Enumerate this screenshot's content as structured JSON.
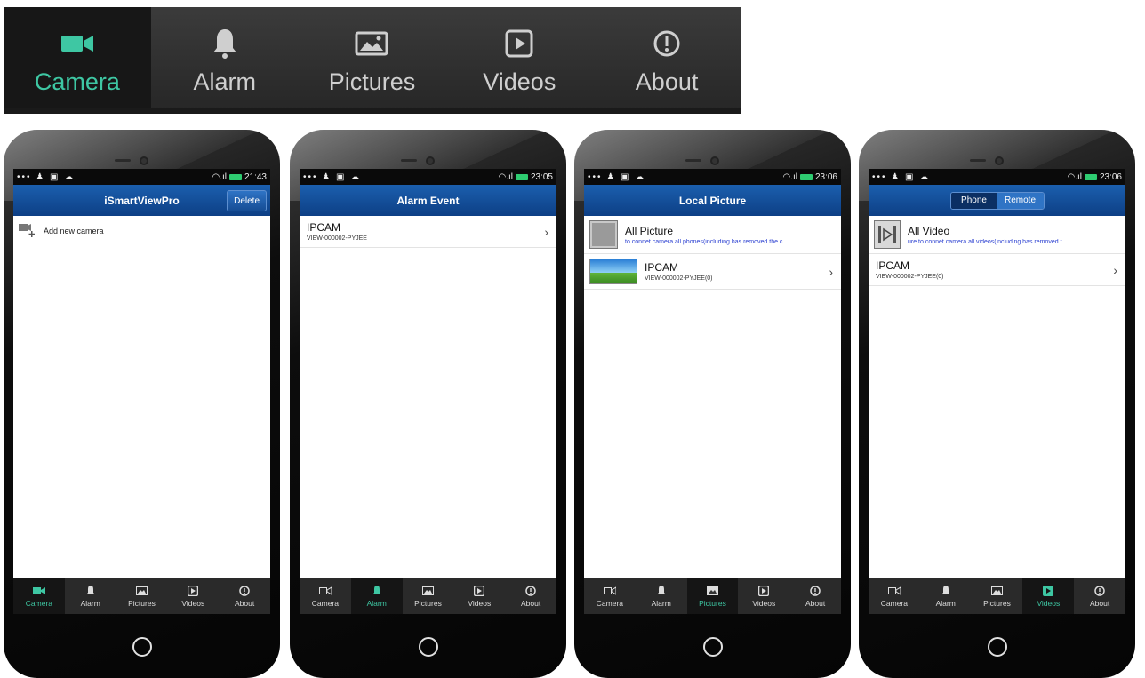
{
  "big_tabs": [
    {
      "label": "Camera",
      "icon": "video-camera-icon",
      "active": true
    },
    {
      "label": "Alarm",
      "icon": "bell-icon",
      "active": false
    },
    {
      "label": "Pictures",
      "icon": "picture-icon",
      "active": false
    },
    {
      "label": "Videos",
      "icon": "play-icon",
      "active": false
    },
    {
      "label": "About",
      "icon": "info-icon",
      "active": false
    }
  ],
  "colors": {
    "accent": "#3ec7a3",
    "header_blue": "#1b5fae",
    "link_blue": "#2a3fd1",
    "tabbar": "#2a2a2a"
  },
  "phones": [
    {
      "status": {
        "left": "••• ♟ ▣ ☁",
        "time": "21:43"
      },
      "header": {
        "title": "iSmartViewPro",
        "button": "Delete"
      },
      "add_camera_label": "Add new camera",
      "tabs": [
        "Camera",
        "Alarm",
        "Pictures",
        "Videos",
        "About"
      ],
      "active_tab": 0
    },
    {
      "status": {
        "left": "••• ♟ ▣ ☁",
        "time": "23:05"
      },
      "header": {
        "title": "Alarm Event"
      },
      "rows": [
        {
          "title": "IPCAM",
          "subtitle": "VIEW-000002-PYJEE"
        }
      ],
      "tabs": [
        "Camera",
        "Alarm",
        "Pictures",
        "Videos",
        "About"
      ],
      "active_tab": 1
    },
    {
      "status": {
        "left": "••• ♟ ▣ ☁",
        "time": "23:06"
      },
      "header": {
        "title": "Local Picture"
      },
      "all_item": {
        "title": "All Picture",
        "subtitle": "to connet camera all phones(including has removed the c"
      },
      "rows": [
        {
          "title": "IPCAM",
          "subtitle": "VIEW-000002-PYJEE(0)"
        }
      ],
      "tabs": [
        "Camera",
        "Alarm",
        "Pictures",
        "Videos",
        "About"
      ],
      "active_tab": 2
    },
    {
      "status": {
        "left": "••• ♟ ▣ ☁",
        "time": "23:06"
      },
      "header": {
        "segments": [
          "Phone",
          "Remote"
        ],
        "active_segment": 0
      },
      "all_item": {
        "title": "All Video",
        "subtitle": "ure to connet camera all videos(including has removed t"
      },
      "rows": [
        {
          "title": "IPCAM",
          "subtitle": "VIEW-000002-PYJEE(0)"
        }
      ],
      "tabs": [
        "Camera",
        "Alarm",
        "Pictures",
        "Videos",
        "About"
      ],
      "active_tab": 3
    }
  ]
}
